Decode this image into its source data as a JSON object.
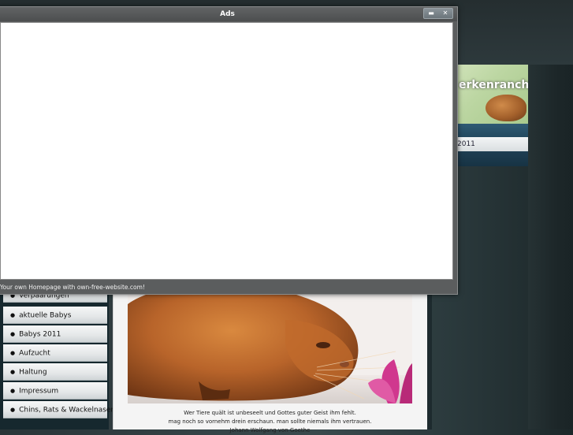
{
  "ads_window": {
    "title": "Ads",
    "footer_text": "Your own Homepage with own-free-website.com!",
    "minimize_glyph": "▬",
    "close_glyph": "✕"
  },
  "site": {
    "banner_title": "erkenranch",
    "nav_item": "2011",
    "menu": [
      "Verpaarungen",
      "aktuelle Babys",
      "Babys 2011",
      "Aufzucht",
      "Haltung",
      "Impressum",
      "Chins, Rats & Wackelnasen"
    ],
    "quote_lines": [
      "Wer Tiere quält ist unbeseelt und Gottes guter Geist ihm fehlt.",
      "mag noch so vornehm drein erschaun. man sollte niemals ihm vertrauen.",
      "Johann Wolfgang von Goethe"
    ]
  },
  "colors": {
    "menu_bg": "#e4e7e8",
    "window_frame": "#5b5d5e",
    "banner_green": "#bcd6a2"
  },
  "icons": {
    "menu_bullet": "bullet-icon",
    "window_minimize": "minimize-icon",
    "window_close": "close-icon"
  }
}
